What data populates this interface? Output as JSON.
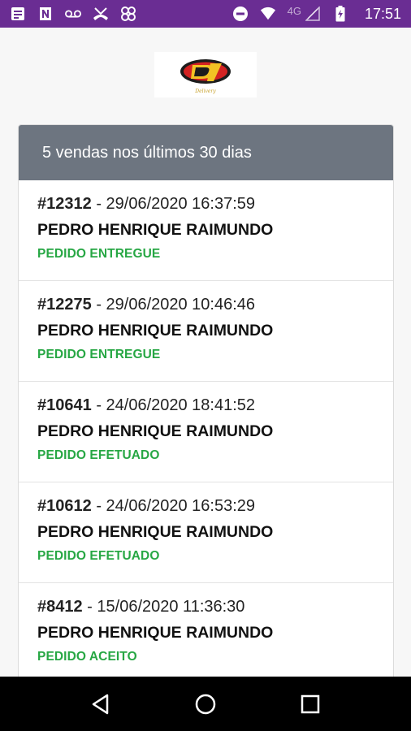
{
  "status_bar": {
    "time": "17:51",
    "network": "4G",
    "left_icons": [
      "message-icon",
      "n-icon",
      "voicemail-icon",
      "missed-call-icon",
      "app-icon"
    ],
    "right_icons": [
      "do-not-disturb-icon",
      "wifi-icon",
      "signal-icon",
      "battery-charging-icon"
    ]
  },
  "logo": {
    "name": "store-logo"
  },
  "card": {
    "header": "5 vendas nos últimos 30 dias",
    "orders": [
      {
        "number": "#12312",
        "datetime": "- 29/06/2020 16:37:59",
        "customer": "PEDRO HENRIQUE RAIMUNDO",
        "status": "PEDIDO ENTREGUE"
      },
      {
        "number": "#12275",
        "datetime": "- 29/06/2020 10:46:46",
        "customer": "PEDRO HENRIQUE RAIMUNDO",
        "status": "PEDIDO ENTREGUE"
      },
      {
        "number": "#10641",
        "datetime": "- 24/06/2020 18:41:52",
        "customer": "PEDRO HENRIQUE RAIMUNDO",
        "status": "PEDIDO EFETUADO"
      },
      {
        "number": "#10612",
        "datetime": "- 24/06/2020 16:53:29",
        "customer": "PEDRO HENRIQUE RAIMUNDO",
        "status": "PEDIDO EFETUADO"
      },
      {
        "number": "#8412",
        "datetime": " - 15/06/2020 11:36:30",
        "customer": "PEDRO HENRIQUE RAIMUNDO",
        "status": "PEDIDO ACEITO"
      }
    ]
  },
  "colors": {
    "status_bar": "#6a2d93",
    "header": "#6d7580",
    "status_text": "#27a744"
  }
}
